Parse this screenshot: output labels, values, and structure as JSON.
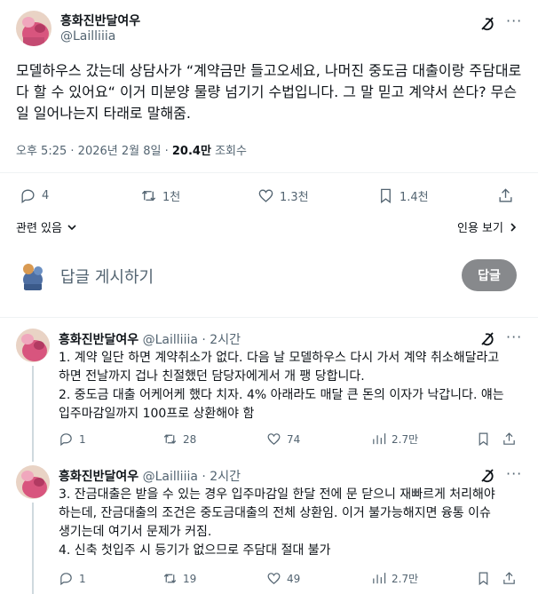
{
  "post": {
    "display_name": "흥화진반달여우",
    "handle": "@Lailliiia",
    "text": "모델하우스 갔는데 상담사가 “계약금만 들고오세요, 나머진 중도금 대출이랑 주담대로 다 할 수 있어요“ 이거 미분양 물량 넘기기 수법입니다. 그 말 믿고 계약서 쓴다? 무슨 일 일어나는지 타래로 말해줌.",
    "time": "오후 5:25",
    "date": "2026년 2월 8일",
    "views_count": "20.4만",
    "views_label": "조회수",
    "separator": "·",
    "stats": {
      "replies": "4",
      "reposts": "1천",
      "likes": "1.3천",
      "bookmarks": "1.4천"
    },
    "related_label": "관련 있음",
    "quotes_label": "인용 보기"
  },
  "reply_box": {
    "placeholder": "답글 게시하기",
    "button_label": "답글"
  },
  "replies": [
    {
      "display_name": "흥화진반달여우",
      "handle": "@Lailliiia",
      "time": "2시간",
      "text_lines": [
        "1. 계약 일단 하면 계약취소가 없다. 다음 날 모델하우스 다시 가서 계약 취소해달라고",
        "하면 전날까지 겁나 친절했던 담당자에게서 개 팽 당합니다.",
        "2. 중도금 대출 어케어케 했다 치자. 4% 아래라도 매달 큰 돈의 이자가 낙갑니다. 얘는",
        "입주마감일까지 100프로 상환해야 함"
      ],
      "stats": {
        "replies": "1",
        "reposts": "28",
        "likes": "74",
        "views": "2.7만"
      }
    },
    {
      "display_name": "흥화진반달여우",
      "handle": "@Lailliiia",
      "time": "2시간",
      "text_lines": [
        "3. 잔금대출은 받을 수 있는 경우 입주마감일 한달 전에 문 닫으니 재빠르게 처리해야",
        "하는데, 잔금대출의 조건은 중도금대출의 전체 상환임. 이거 불가능해지면 융통 이슈",
        "생기는데 여기서 문제가 커짐.",
        "4. 신축 첫입주 시 등기가 없으므로 주담대 절대 불가"
      ],
      "stats": {
        "replies": "1",
        "reposts": "19",
        "likes": "49",
        "views": "2.7만"
      }
    }
  ],
  "colors": {
    "text": "#0f1419",
    "secondary": "#536471",
    "divider": "#eff3f4",
    "button_disabled": "#87898c"
  },
  "icons": [
    "grok-icon",
    "more-icon",
    "reply-icon",
    "repost-icon",
    "like-icon",
    "bookmark-icon",
    "share-icon",
    "views-icon",
    "chevron-down-icon"
  ]
}
